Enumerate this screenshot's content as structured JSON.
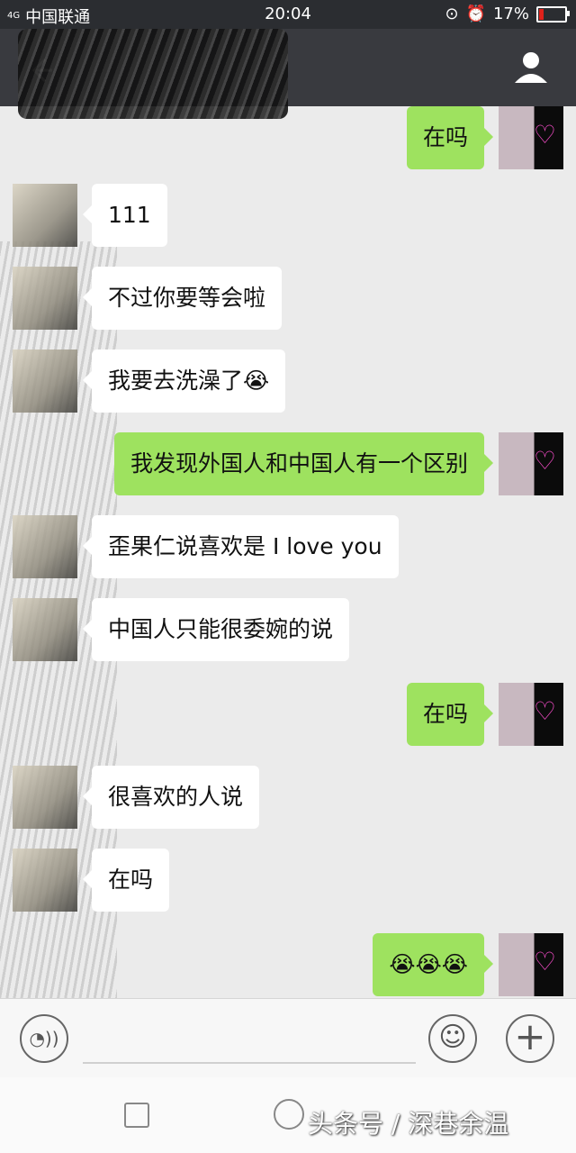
{
  "statusbar": {
    "signal": "4G",
    "carrier": "中国联通",
    "time": "20:04",
    "battery": "17%",
    "battery_level": 0.17
  },
  "header": {
    "back_icon": "back-arrow-icon",
    "profile_icon": "person-icon"
  },
  "messages": [
    {
      "dir": "out",
      "text": "在吗"
    },
    {
      "dir": "in",
      "text": "111"
    },
    {
      "dir": "in",
      "text": "不过你要等会啦"
    },
    {
      "dir": "in",
      "text": "我要去洗澡了😭"
    },
    {
      "dir": "out",
      "text": "我发现外国人和中国人有一个区别"
    },
    {
      "dir": "in",
      "text": "歪果仁说喜欢是 I love you"
    },
    {
      "dir": "in",
      "text": "中国人只能很委婉的说"
    },
    {
      "dir": "out",
      "text": "在吗"
    },
    {
      "dir": "in",
      "text": "很喜欢的人说"
    },
    {
      "dir": "in",
      "text": "在吗"
    },
    {
      "dir": "out",
      "text": "😭😭😭"
    }
  ],
  "inputbar": {
    "voice_icon": "voice-icon",
    "emoji_icon": "emoji-icon",
    "plus_icon": "plus-icon"
  },
  "navbar": {
    "watermark": "头条号 / 深巷余温"
  }
}
